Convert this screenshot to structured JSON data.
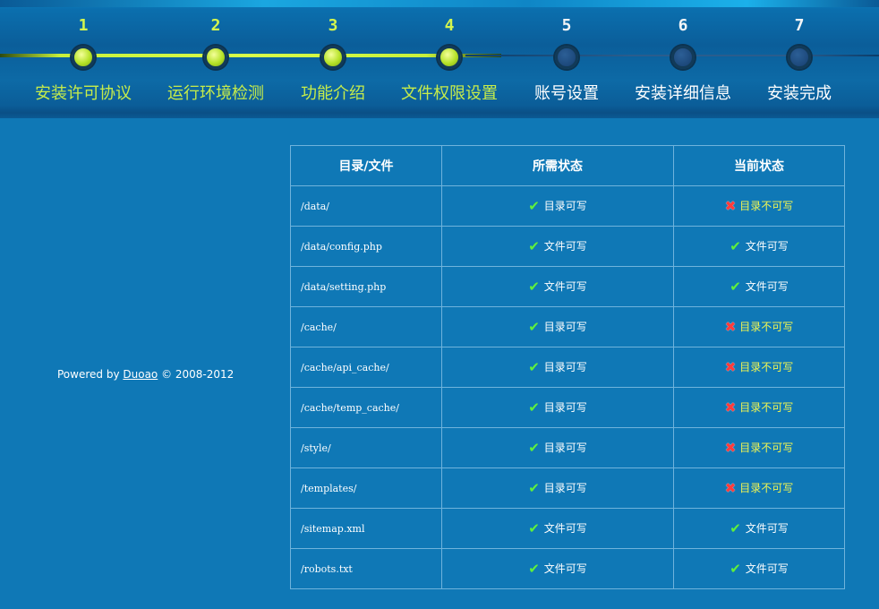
{
  "steps": [
    {
      "num": "1",
      "label": "安装许可协议",
      "state": "done"
    },
    {
      "num": "2",
      "label": "运行环境检测",
      "state": "done"
    },
    {
      "num": "3",
      "label": "功能介绍",
      "state": "done"
    },
    {
      "num": "4",
      "label": "文件权限设置",
      "state": "done"
    },
    {
      "num": "5",
      "label": "账号设置",
      "state": "todo"
    },
    {
      "num": "6",
      "label": "安装详细信息",
      "state": "todo"
    },
    {
      "num": "7",
      "label": "安装完成",
      "state": "todo"
    }
  ],
  "footer": {
    "prefix": "Powered by ",
    "link": "Duoao",
    "suffix": " © 2008-2012"
  },
  "table": {
    "headers": [
      "目录/文件",
      "所需状态",
      "当前状态"
    ],
    "rows": [
      {
        "path": "/data/",
        "required": "目录可写",
        "current": "目录不可写",
        "ok": false
      },
      {
        "path": "/data/config.php",
        "required": "文件可写",
        "current": "文件可写",
        "ok": true
      },
      {
        "path": "/data/setting.php",
        "required": "文件可写",
        "current": "文件可写",
        "ok": true
      },
      {
        "path": "/cache/",
        "required": "目录可写",
        "current": "目录不可写",
        "ok": false
      },
      {
        "path": "/cache/api_cache/",
        "required": "目录可写",
        "current": "目录不可写",
        "ok": false
      },
      {
        "path": "/cache/temp_cache/",
        "required": "目录可写",
        "current": "目录不可写",
        "ok": false
      },
      {
        "path": "/style/",
        "required": "目录可写",
        "current": "目录不可写",
        "ok": false
      },
      {
        "path": "/templates/",
        "required": "目录可写",
        "current": "目录不可写",
        "ok": false
      },
      {
        "path": "/sitemap.xml",
        "required": "文件可写",
        "current": "文件可写",
        "ok": true
      },
      {
        "path": "/robots.txt",
        "required": "文件可写",
        "current": "文件可写",
        "ok": true
      }
    ]
  },
  "icons": {
    "ok": "check-icon",
    "bad": "cross-icon"
  },
  "colors": {
    "background": "#0f78b6",
    "done": "#c6ec4a",
    "warning_text": "#f1f552",
    "ok_icon": "#5ff03c",
    "bad_icon": "#ff3b3b"
  }
}
